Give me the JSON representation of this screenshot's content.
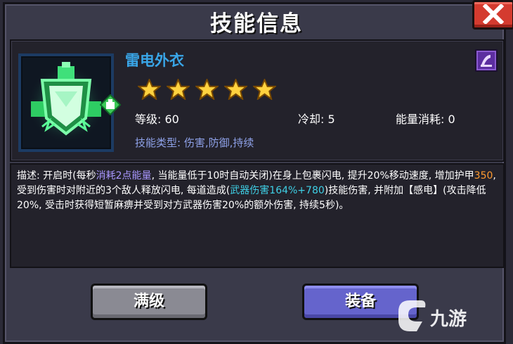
{
  "window": {
    "title": "技能信息",
    "close_label": "X"
  },
  "skill": {
    "name": "雷电外衣",
    "stars": 5,
    "level": "等级: 60",
    "cooldown": "冷却: 5",
    "energy_cost": "能量消耗: 0",
    "type": "技能类型: 伤害,防御,持续",
    "icon": "green-shield-lightning-icon",
    "tag_icon": "green-tag-icon",
    "book_icon": "purple-spellbook-icon"
  },
  "description": {
    "p1": "描述: 开启时(每秒",
    "p2": "消耗2点能量",
    "p3": ", 当能量低于10时自动关闭)在身上包裹闪电, 提升20%移动速度, 增加护甲",
    "p4": "350",
    "p5": ", 受到伤害时对附近的3个敌人释放闪电, 每道造成(",
    "p6": "武器伤害164%+780",
    "p7": ")技能伤害, 并附加【感电】(攻击降低20%, 受击时获得短暂麻痹并受到对方武器伤害20%的额外伤害, 持续5秒)。"
  },
  "buttons": {
    "max_level": "满级",
    "equip": "装备"
  },
  "watermark": {
    "text": "九游",
    "icon": "jiuyou-logo-icon"
  },
  "colors": {
    "name": "#39a6e8",
    "type": "#8ea1e8",
    "highlight_purple": "#a997ff",
    "highlight_orange": "#ff9a2f",
    "highlight_cyan": "#3fd0e6",
    "equip_button": "#6564cc",
    "max_button": "#8a8a93",
    "close_button": "#d43b2f"
  }
}
